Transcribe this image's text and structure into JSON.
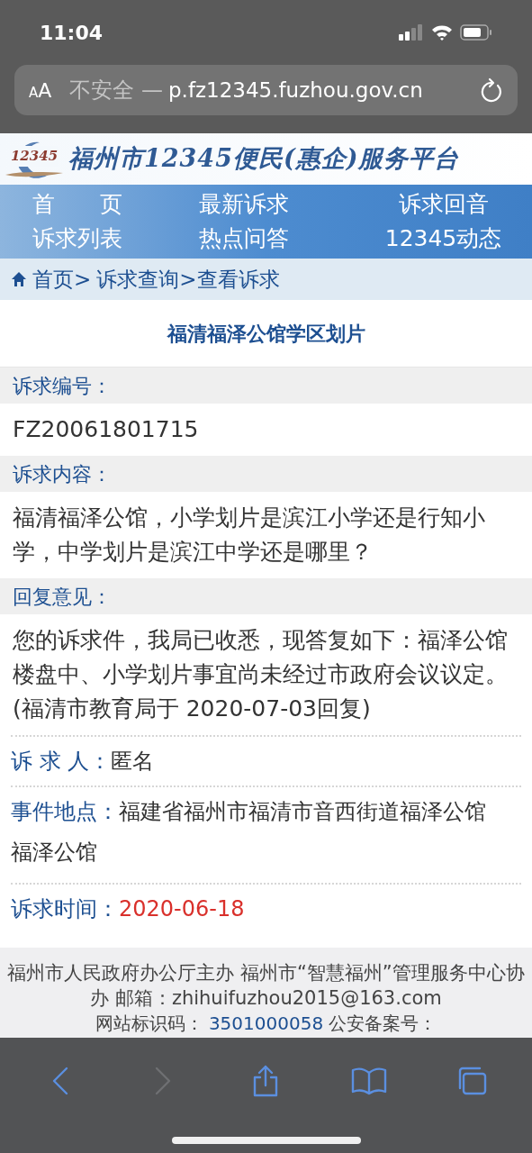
{
  "status_bar": {
    "time": "11:04"
  },
  "browser": {
    "text_size_button": {
      "small": "A",
      "large": "A"
    },
    "security": "不安全 —",
    "url": "p.fz12345.fuzhou.gov.cn"
  },
  "site": {
    "logo_number": "12345",
    "title": "福州市12345便民(惠企)服务平台"
  },
  "nav": [
    {
      "label": "首　　页"
    },
    {
      "label": "最新诉求"
    },
    {
      "label": "诉求回音"
    },
    {
      "label": "诉求列表"
    },
    {
      "label": "热点问答"
    },
    {
      "label": "12345动态"
    }
  ],
  "breadcrumb": [
    "首页>",
    "诉求查询>查看诉求"
  ],
  "page_title": "福清福泽公馆学区划片",
  "sections": [
    {
      "label": "诉求编号：",
      "text": "FZ20061801715"
    },
    {
      "label": "诉求内容：",
      "text": "福清福泽公馆，小学划片是滨江小学还是行知小学，中学划片是滨江中学还是哪里？"
    },
    {
      "label": "回复意见：",
      "text": "您的诉求件，我局已收悉，现答复如下：福泽公馆楼盘中、小学划片事宜尚未经过市政府会议议定。(福清市教育局于 2020-07-03回复)"
    }
  ],
  "details": [
    {
      "label": "诉 求 人：",
      "value": "匿名",
      "highlight": false
    },
    {
      "label": "事件地点：",
      "value": "福建省福州市福清市音西街道福泽公馆",
      "extra": "福泽公馆",
      "highlight": false
    },
    {
      "label": "诉求时间：",
      "value": "2020-06-18",
      "highlight": true
    }
  ],
  "footer": {
    "line1": "福州市人民政府办公厅主办 福州市“智慧福州”管理服务中心协办 邮箱：zhihuifuzhou2015@163.com",
    "line2_label": "网站标识码：",
    "line2_link": "3501000058",
    "line2_suffix": "公安备案号："
  },
  "toolbar": [
    {
      "kind": "back",
      "disabled": false
    },
    {
      "kind": "forward",
      "disabled": true
    },
    {
      "kind": "share",
      "disabled": false
    },
    {
      "kind": "bookmarks",
      "disabled": false
    },
    {
      "kind": "tabs",
      "disabled": false
    }
  ]
}
